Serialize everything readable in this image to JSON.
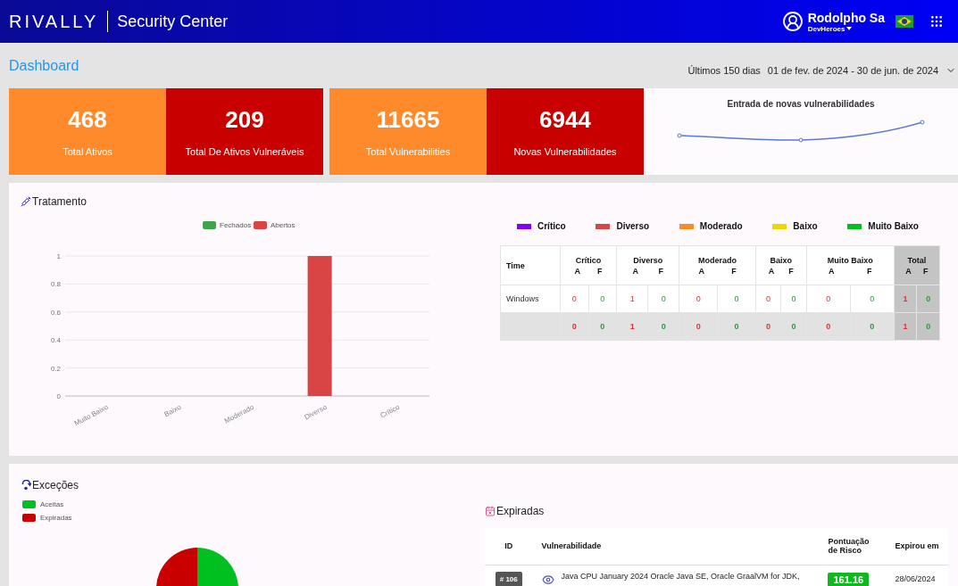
{
  "header": {
    "logo": "RIVALLY",
    "app_title": "Security Center",
    "user_name": "Rodolpho Sa",
    "organization": "DevHeroes"
  },
  "page_title": "Dashboard",
  "date_range": {
    "preset": "Últimos 150 dias",
    "range": "01 de fev. de 2024 - 30 de jun. de 2024"
  },
  "stats": [
    {
      "value": "468",
      "label": "Total Ativos",
      "color": "#ff8a2b"
    },
    {
      "value": "209",
      "label": "Total De Ativos Vulneráveis",
      "color": "#c80000"
    },
    {
      "value": "11665",
      "label": "Total Vulnerabilities",
      "color": "#ff8a2b"
    },
    {
      "value": "6944",
      "label": "Novas Vulnerabilidades",
      "color": "#c80000"
    }
  ],
  "trend_card": {
    "title": "Entrada de novas vulnerabilidades"
  },
  "tratamento": {
    "title": "Tratamento",
    "chart_data": {
      "type": "bar",
      "categories": [
        "Muito Baixo",
        "Baixo",
        "Moderado",
        "Diverso",
        "Crítico"
      ],
      "series": [
        {
          "name": "Fechados",
          "color": "#3fa54a",
          "values": [
            0,
            0,
            0,
            0,
            0
          ]
        },
        {
          "name": "Abertos",
          "color": "#d94545",
          "values": [
            0,
            0,
            0,
            1,
            0
          ]
        }
      ],
      "ylim": [
        0,
        1
      ],
      "grid": true,
      "yticks": [
        0,
        0.2,
        0.4,
        0.6,
        0.8,
        1
      ]
    },
    "severity_legend": [
      {
        "label": "Crítico",
        "color": "#7f00ff"
      },
      {
        "label": "Diverso",
        "color": "#d94545"
      },
      {
        "label": "Moderado",
        "color": "#ff8a2b"
      },
      {
        "label": "Baixo",
        "color": "#eed600"
      },
      {
        "label": "Muito Baixo",
        "color": "#00c020"
      }
    ],
    "table": {
      "first_column": "Time",
      "groups": [
        {
          "label": "Crítico",
          "sub": [
            "A",
            "F"
          ]
        },
        {
          "label": "Diverso",
          "sub": [
            "A",
            "F"
          ]
        },
        {
          "label": "Moderado",
          "sub": [
            "A",
            "F"
          ]
        },
        {
          "label": "Baixo",
          "sub": [
            "A",
            "F"
          ]
        },
        {
          "label": "Muito Baixo",
          "sub": [
            "A",
            "F"
          ]
        },
        {
          "label": "Total",
          "sub": [
            "A",
            "F"
          ],
          "kind": "total"
        }
      ],
      "rows": [
        {
          "name": "Windows",
          "kind": "row",
          "cells": [
            "0",
            "0",
            "1",
            "0",
            "0",
            "0",
            "0",
            "0",
            "0",
            "0",
            "1",
            "0"
          ]
        },
        {
          "kind": "totals",
          "cells": [
            "0",
            "0",
            "1",
            "0",
            "0",
            "0",
            "0",
            "0",
            "0",
            "0",
            "1",
            "0"
          ]
        }
      ]
    }
  },
  "excecoes": {
    "title": "Exceções",
    "legend": [
      {
        "label": "Aceitas",
        "color": "#00c020"
      },
      {
        "label": "Expiradas",
        "color": "#c80000"
      }
    ]
  },
  "expiradas": {
    "title": "Expiradas",
    "columns": [
      "ID",
      "Vulnerabilidade",
      "Pontuação de Risco",
      "Expirou em"
    ],
    "rows": [
      {
        "id": "# 106",
        "vulnerability": "Java CPU January 2024 Oracle Java SE, Oracle GraalVM for JDK,",
        "score": "161.16",
        "expired": "28/06/2024"
      }
    ]
  }
}
